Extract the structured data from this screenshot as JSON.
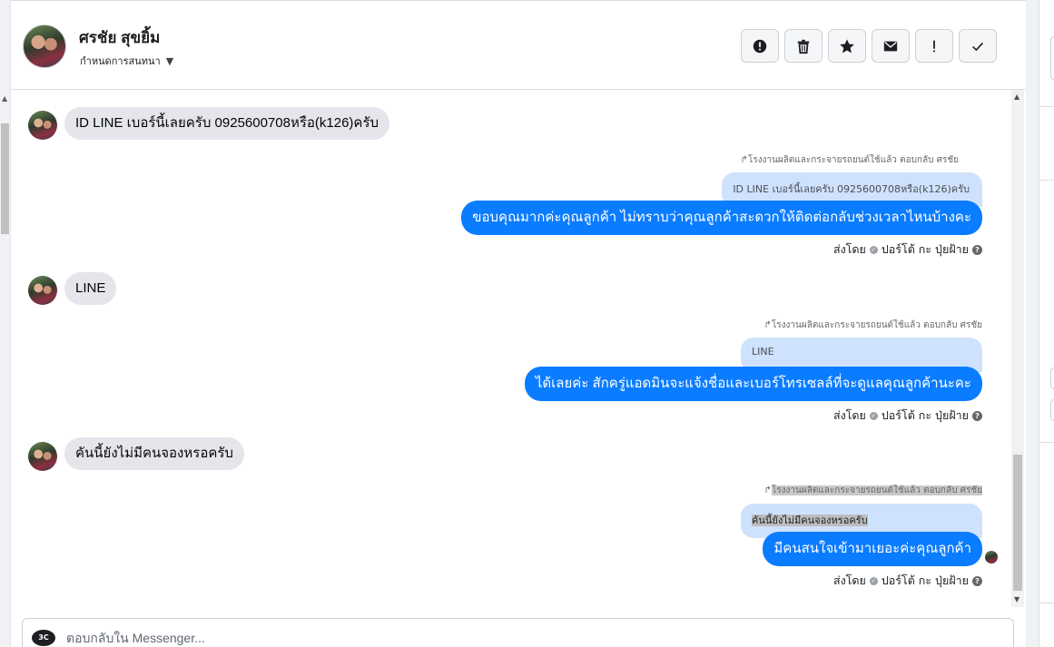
{
  "header": {
    "contact_name": "ศรชัย สุขยิ้ม",
    "assign_label": "กำหนดการสนทนา",
    "toolbar": [
      {
        "name": "mark-spam-button",
        "icon": "alert-circle-icon"
      },
      {
        "name": "delete-button",
        "icon": "trash-icon"
      },
      {
        "name": "star-button",
        "icon": "star-icon"
      },
      {
        "name": "mark-unread-button",
        "icon": "envelope-icon"
      },
      {
        "name": "follow-up-button",
        "icon": "exclamation-icon"
      },
      {
        "name": "mark-done-button",
        "icon": "check-icon"
      }
    ]
  },
  "messages": [
    {
      "incoming": "ID LINE เบอร์นี้เลยครับ 0925600708หรือ(k126)ครับ",
      "reply_label": "โรงงานผลิตและกระจายรถยนต์ใช้แล้ว ตอบกลับ ศรชัย",
      "quote": "ID LINE เบอร์นี้เลยครับ 0925600708หรือ(k126)ครับ",
      "outgoing": "ขอบคุณมากค่ะคุณลูกค้า ไม่ทราบว่าคุณลูกค้าสะดวกให้ติดต่อกลับช่วงเวลาไหนบ้างคะ",
      "sent_by": "ส่งโดย",
      "sender": "ปอร์โต้ กะ ปุ่ยฝ้าย"
    },
    {
      "incoming": "LINE",
      "reply_label": "โรงงานผลิตและกระจายรถยนต์ใช้แล้ว ตอบกลับ ศรชัย",
      "quote": "LINE",
      "outgoing": "ได้เลยค่ะ สักครู่แอดมินจะแจ้งชื่อและเบอร์โทรเซลล์ที่จะดูแลคุณลูกค้านะคะ",
      "sent_by": "ส่งโดย",
      "sender": "ปอร์โต้ กะ ปุ่ยฝ้าย"
    },
    {
      "incoming": "คันนี้ยังไม่มีคนจองหรอครับ",
      "reply_label": "โรงงานผลิตและกระจายรถยนต์ใช้แล้ว ตอบกลับ ศรชัย",
      "quote": "คันนี้ยังไม่มีคนจองหรอครับ",
      "outgoing": "มีคนสนใจเข้ามาเยอะค่ะคุณลูกค้า",
      "sent_by": "ส่งโดย",
      "sender": "ปอร์โต้ กะ ปุ่ยฝ้าย"
    }
  ],
  "composer": {
    "placeholder": "ตอบกลับใน Messenger...",
    "logo_text": "3C"
  },
  "colors": {
    "outgoing_bubble": "#0a7cff",
    "quote_bubble": "#cfe2fd",
    "incoming_bubble": "#e4e6eb"
  }
}
